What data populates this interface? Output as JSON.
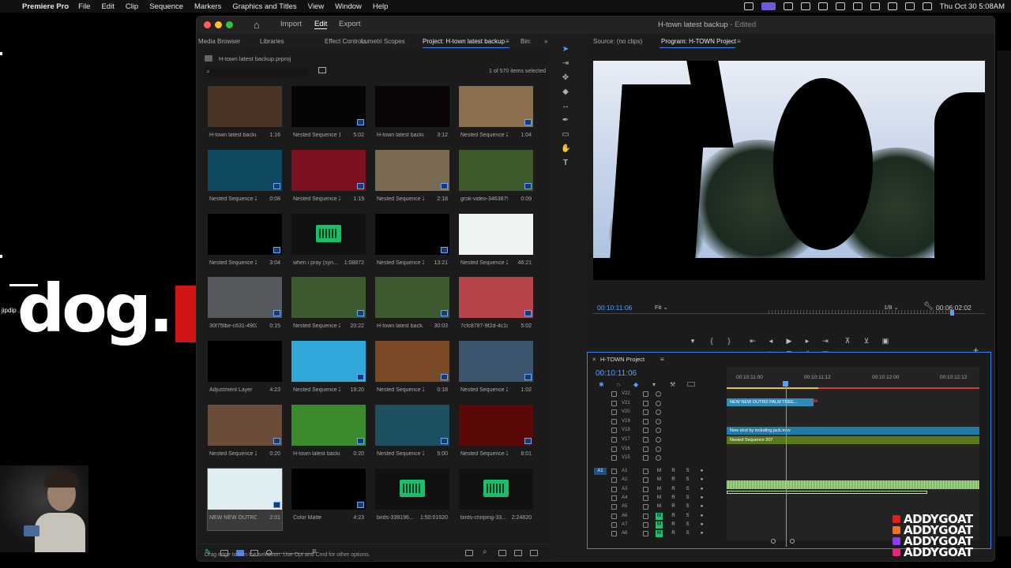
{
  "menubar": {
    "app": "Premiere Pro",
    "items": [
      "File",
      "Edit",
      "Clip",
      "Sequence",
      "Markers",
      "Graphics and Titles",
      "View",
      "Window",
      "Help"
    ],
    "clock": "Thu Oct 30  5:08AM"
  },
  "overlay": {
    "dog_text": "dog.",
    "dog_file": "jipdip .png",
    "goat_lines": [
      "ADDYGOAT",
      "ADDYGOAT",
      "ADDYGOAT",
      "ADDYGOAT"
    ],
    "goat_colors": [
      "#e31d1d",
      "#f2702c",
      "#8a3cf6",
      "#e2267a"
    ]
  },
  "window": {
    "tabs": [
      "Import",
      "Edit",
      "Export"
    ],
    "active_tab": "Edit",
    "doc_title": "H-town latest backup",
    "doc_status": " - Edited"
  },
  "project_panel": {
    "tabs": [
      "Media Browser",
      "Libraries",
      "Effect Controls",
      "Lumetri Scopes",
      "Project: H-town latest backup",
      "Bin:"
    ],
    "file": "H-town latest backup.prproj",
    "selection": "1 of 570 items selected",
    "items": [
      {
        "name": "H-town latest backup...",
        "dur": "1:16",
        "thumb": "#4a3426",
        "badge": false
      },
      {
        "name": "Nested Sequence 197",
        "dur": "5:02",
        "thumb": "#050505",
        "badge": true
      },
      {
        "name": "H-town latest backup...",
        "dur": "3:12",
        "thumb": "#0a0404",
        "badge": false
      },
      {
        "name": "Nested Sequence 200",
        "dur": "1:04",
        "thumb": "#8c6f4c",
        "badge": true
      },
      {
        "name": "Nested Sequence 201",
        "dur": "0:08",
        "thumb": "#0f4a62",
        "badge": true
      },
      {
        "name": "Nested Sequence 202",
        "dur": "1:19",
        "thumb": "#7c1020",
        "badge": true
      },
      {
        "name": "Nested Sequence 203",
        "dur": "2:18",
        "thumb": "#7a6a52",
        "badge": true
      },
      {
        "name": "grok-video-34638796...",
        "dur": "0:09",
        "thumb": "#3f5a2a",
        "badge": true
      },
      {
        "name": "Nested Sequence 204",
        "dur": "3:04",
        "thumb": "#000000",
        "badge": true
      },
      {
        "name": "when i pray (syn...",
        "dur": "1:08872",
        "thumb": "wave",
        "badge": false
      },
      {
        "name": "Nested Sequence 205",
        "dur": "13:21",
        "thumb": "#000000",
        "badge": true
      },
      {
        "name": "Nested Sequence 207",
        "dur": "46:21",
        "thumb": "#edf3f3",
        "badge": false
      },
      {
        "name": "30f75fbe-c631-4902-...",
        "dur": "0:15",
        "thumb": "#565a5f",
        "badge": true
      },
      {
        "name": "Nested Sequence 208",
        "dur": "20:22",
        "thumb": "#3c5a2e",
        "badge": true
      },
      {
        "name": "H-town latest back...",
        "dur": "30:03",
        "thumb": "#3c5a2e",
        "badge": true
      },
      {
        "name": "7cfc8787-9f2d-4c1c-...",
        "dur": "5:02",
        "thumb": "#b8424a",
        "badge": true
      },
      {
        "name": "Adjustment Layer",
        "dur": "4:23",
        "thumb": "#000000",
        "badge": false
      },
      {
        "name": "Nested Sequence 210",
        "dur": "19:20",
        "thumb": "#2fa8d8",
        "badge": true
      },
      {
        "name": "Nested Sequence 211",
        "dur": "0:18",
        "thumb": "#7a4a26",
        "badge": true
      },
      {
        "name": "Nested Sequence 212",
        "dur": "1:02",
        "thumb": "#3d556e",
        "badge": true
      },
      {
        "name": "Nested Sequence 214",
        "dur": "0:20",
        "thumb": "#6b4c38",
        "badge": true
      },
      {
        "name": "H-town latest backup...",
        "dur": "0:20",
        "thumb": "#3b8a2b",
        "badge": true
      },
      {
        "name": "Nested Sequence 216",
        "dur": "5:00",
        "thumb": "#1c4f5f",
        "badge": true
      },
      {
        "name": "Nested Sequence 217",
        "dur": "8:01",
        "thumb": "#5a0808",
        "badge": true
      },
      {
        "name": "NEW NEW OUTRO P...",
        "dur": "2:01",
        "thumb": "#dfeef0",
        "badge": true,
        "selected": true
      },
      {
        "name": "Color Matte",
        "dur": "4:23",
        "thumb": "#000000",
        "badge": true
      },
      {
        "name": "birds-339196...",
        "dur": "1:50:01920",
        "thumb": "wave",
        "badge": false
      },
      {
        "name": "birds-chirping-33...",
        "dur": "2:24820",
        "thumb": "wave",
        "badge": false
      }
    ]
  },
  "program_monitor": {
    "source_tab": "Source: (no clips)",
    "program_tab": "Program: H-TOWN Project",
    "timecode": "00:10:11:06",
    "fit": "Fit",
    "resolution": "1/8",
    "duration": "00:06:02:02"
  },
  "timeline": {
    "title": "H-TOWN Project",
    "timecode": "00:10:11:06",
    "ruler": [
      "00:10:11:00",
      "00:10:11:12",
      "00:10:12:00",
      "00:10:12:12"
    ],
    "video_tracks": [
      "V22",
      "V21",
      "V20",
      "V19",
      "V18",
      "V17",
      "V16",
      "V15"
    ],
    "audio_tracks": [
      "A1",
      "A2",
      "A3",
      "A4",
      "A5",
      "A6",
      "A7",
      "A8"
    ],
    "clips": [
      {
        "name": "NEW NEW OUTRO PALM TREE...",
        "track": "V21"
      },
      {
        "name": "New shot by including jack.mov",
        "track": "V18"
      },
      {
        "name": "Nested Sequence 207",
        "track": "V17"
      }
    ]
  },
  "status_bar": "Drag edge to trim the selection. Use Opt and Cmd for other options."
}
